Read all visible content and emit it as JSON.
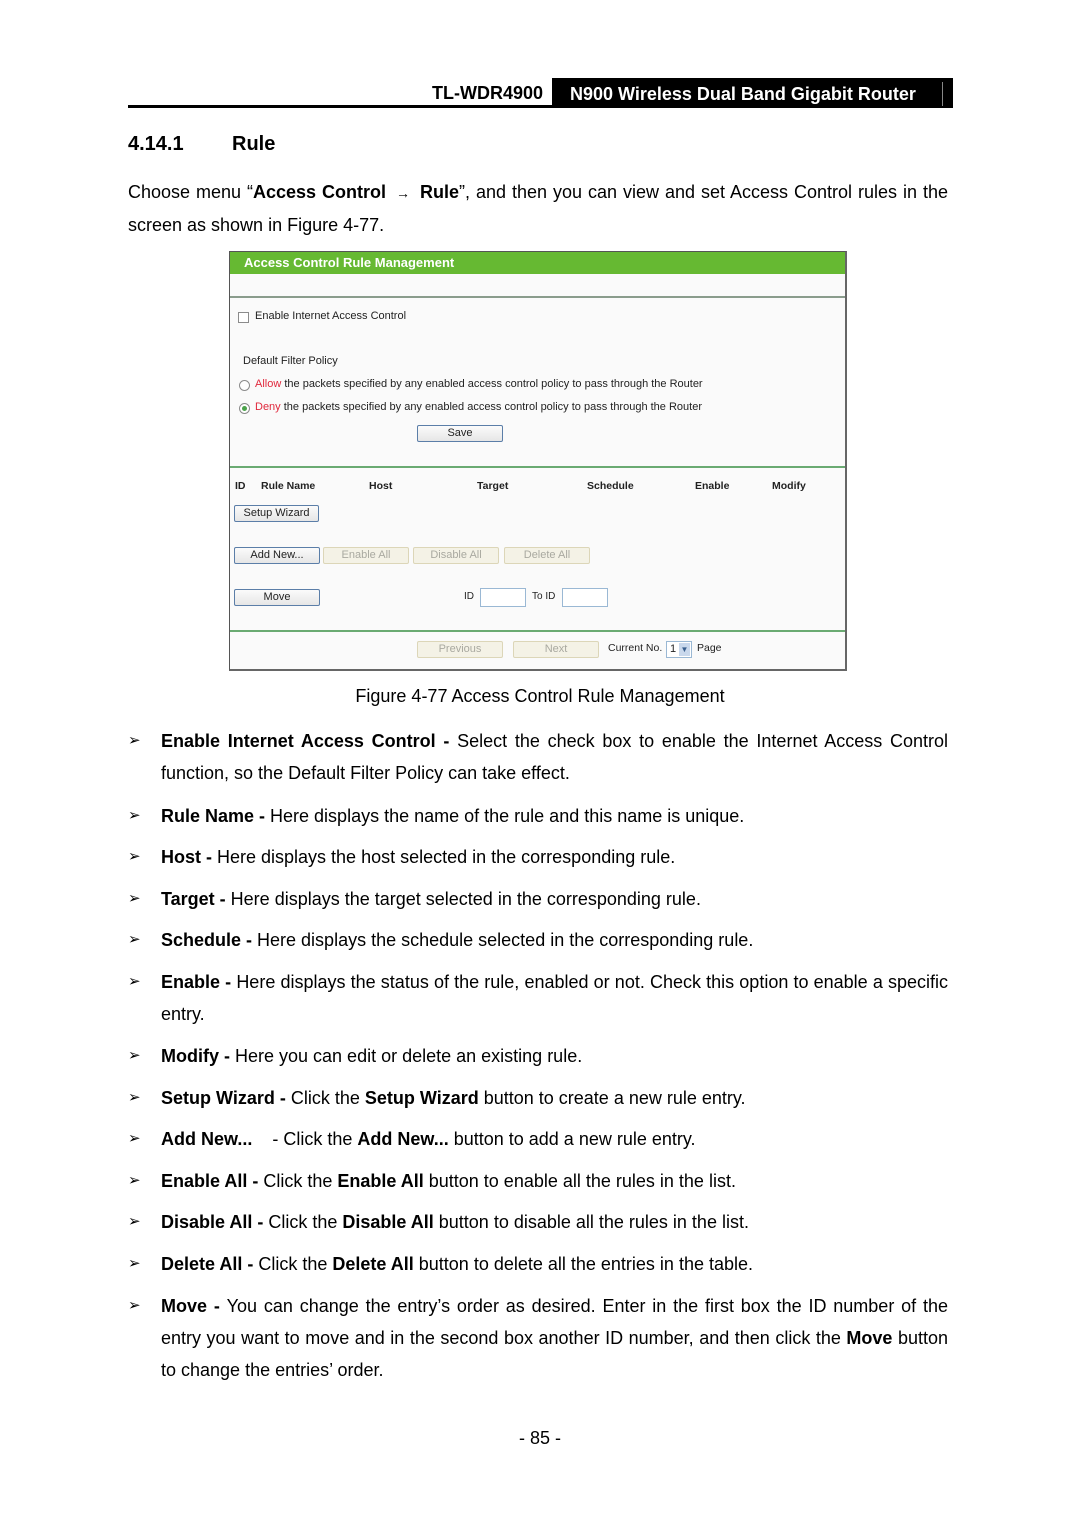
{
  "running_header": {
    "model": "TL-WDR4900",
    "product": "N900 Wireless Dual Band Gigabit Router"
  },
  "section": {
    "number": "4.14.1",
    "title": "Rule"
  },
  "intro": {
    "prefix": "Choose menu “",
    "menu_path_1": "Access Control",
    "arrow": "→",
    "menu_path_2": "Rule",
    "suffix": "”, and then you can view and set Access Control rules in the screen as shown in Figure 4-77."
  },
  "screenshot": {
    "title": "Access Control Rule Management",
    "accent_color": "#66b932",
    "enable_checkbox": {
      "label": "Enable Internet Access Control",
      "checked": false
    },
    "default_filter_policy_label": "Default Filter Policy",
    "policies": [
      {
        "keyword": "Allow",
        "text": " the packets specified by any enabled access control policy to pass through the Router",
        "selected": false
      },
      {
        "keyword": "Deny",
        "text": " the packets specified by any enabled access control policy to pass through the Router",
        "selected": true
      }
    ],
    "save_button": "Save",
    "table_headers": [
      "ID",
      "Rule Name",
      "Host",
      "Target",
      "Schedule",
      "Enable",
      "Modify"
    ],
    "setup_wizard_button": "Setup Wizard",
    "add_new_button": "Add New...",
    "enable_all_button": "Enable All",
    "disable_all_button": "Disable All",
    "delete_all_button": "Delete All",
    "move_button": "Move",
    "id_label": "ID",
    "to_id_label": "To ID",
    "id_value": "",
    "to_id_value": "",
    "previous_button": "Previous",
    "next_button": "Next",
    "current_no_label": "Current No.",
    "current_page": "1",
    "page_label": "Page"
  },
  "caption": "Figure 4-77 Access Control Rule Management",
  "bullets": [
    {
      "term": "Enable Internet Access Control - ",
      "text": "Select the check box to enable the Internet Access Control function, so the Default Filter Policy can take effect."
    },
    {
      "term": "Rule Name - ",
      "text": "Here displays the name of the rule and this name is unique."
    },
    {
      "term": "Host - ",
      "text": "Here displays the host selected in the corresponding rule."
    },
    {
      "term": "Target - ",
      "text": "Here displays the target selected in the corresponding rule."
    },
    {
      "term": "Schedule - ",
      "text": "Here displays the schedule selected in the corresponding rule."
    },
    {
      "term": "Enable - ",
      "text": "Here displays the status of the rule, enabled or not. Check this option to enable a specific entry."
    },
    {
      "term": "Modify - ",
      "text": "Here you can edit or delete an existing rule."
    },
    {
      "term": "Setup Wizard - ",
      "pre": "Click the ",
      "bold": "Setup Wizard",
      "post": " button to create a new rule entry."
    },
    {
      "term": "Add New...",
      "pre": "    - Click the ",
      "bold": "Add New...",
      "post": " button to add a new rule entry."
    },
    {
      "term": "Enable All - ",
      "pre": "Click the ",
      "bold": "Enable All",
      "post": " button to enable all the rules in the list."
    },
    {
      "term": "Disable All - ",
      "pre": "Click the ",
      "bold": "Disable All",
      "post": " button to disable all the rules in the list."
    },
    {
      "term": "Delete All - ",
      "pre": "Click the ",
      "bold": "Delete All",
      "post": " button to delete all the entries in the table."
    },
    {
      "term": "Move - ",
      "text": "You can change the entry’s order as desired. Enter in the first box the ID number of the entry you want to move and in the second box another ID number, and then click the ",
      "bold2": "Move",
      "post2": " button to change the entries’ order."
    }
  ],
  "bullet_marker": "➢",
  "page_number": "- 85 -"
}
